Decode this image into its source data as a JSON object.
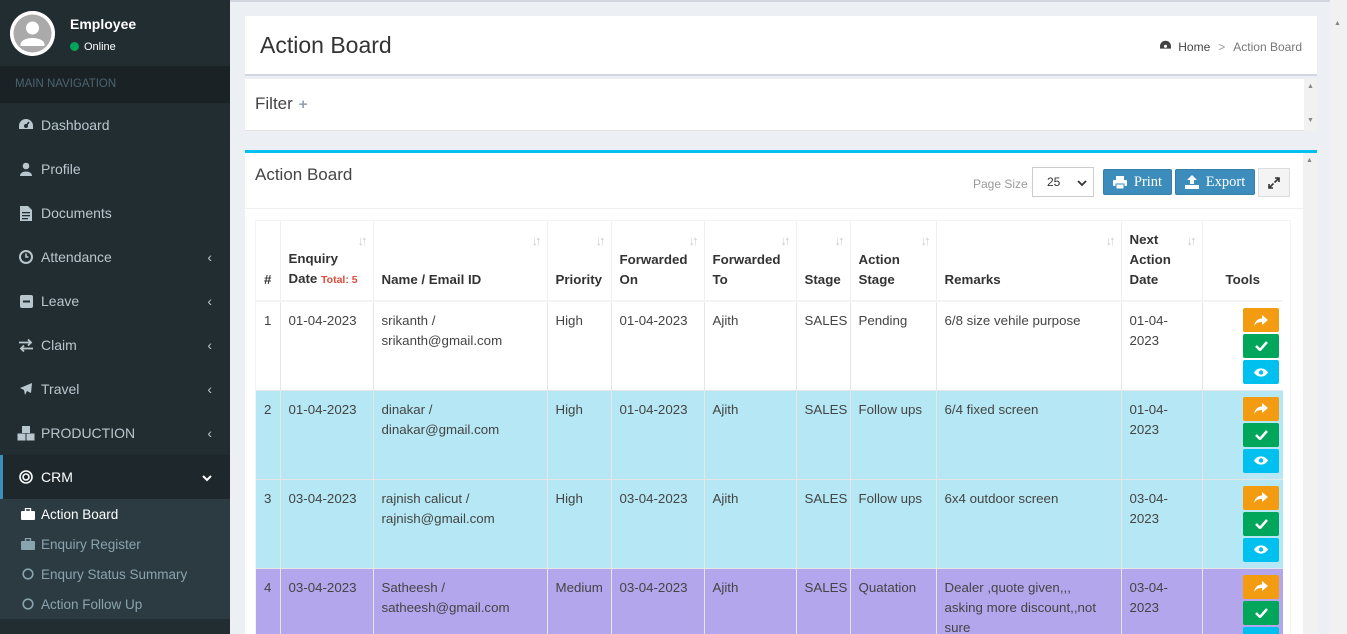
{
  "user": {
    "name": "Employee",
    "status": "Online"
  },
  "nav": {
    "header": "MAIN NAVIGATION",
    "items": [
      {
        "label": "Dashboard",
        "icon": "dashboard-icon",
        "chevron": false
      },
      {
        "label": "Profile",
        "icon": "user-icon",
        "chevron": false
      },
      {
        "label": "Documents",
        "icon": "document-icon",
        "chevron": false
      },
      {
        "label": "Attendance",
        "icon": "clock-icon",
        "chevron": true
      },
      {
        "label": "Leave",
        "icon": "minus-square-icon",
        "chevron": true
      },
      {
        "label": "Claim",
        "icon": "exchange-icon",
        "chevron": true
      },
      {
        "label": "Travel",
        "icon": "plane-icon",
        "chevron": true
      },
      {
        "label": "PRODUCTION",
        "icon": "cubes-icon",
        "chevron": true
      },
      {
        "label": "CRM",
        "icon": "target-icon",
        "chevron": true
      }
    ],
    "crm_sub": [
      {
        "label": "Action Board",
        "icon": "briefcase-icon"
      },
      {
        "label": "Enquiry Register",
        "icon": "briefcase-icon"
      },
      {
        "label": "Enqury Status Summary",
        "icon": "circle-icon"
      },
      {
        "label": "Action Follow Up",
        "icon": "circle-icon"
      }
    ]
  },
  "page": {
    "title": "Action Board",
    "breadcrumb_home": "Home",
    "breadcrumb_sep": ">",
    "breadcrumb_current": "Action Board"
  },
  "filter": {
    "title": "Filter",
    "plus": "+"
  },
  "board": {
    "title": "Action Board",
    "page_size_label": "Page Size",
    "page_size_value": "25",
    "print_label": "Print",
    "export_label": "Export"
  },
  "table": {
    "headers": {
      "num": "#",
      "enquiry_date": "Enquiry Date",
      "total": "Total: 5",
      "name_email": "Name / Email ID",
      "priority": "Priority",
      "forwarded_on": "Forwarded On",
      "forwarded_to": "Forwarded To",
      "stage": "Stage",
      "action_stage": "Action Stage",
      "remarks": "Remarks",
      "next_action_date": "Next Action Date",
      "tools": "Tools"
    },
    "rows": [
      {
        "num": "1",
        "date": "01-04-2023",
        "name": "srikanth /",
        "email": "srikanth@gmail.com",
        "priority": "High",
        "fwd_on": "01-04-2023",
        "fwd_to": "Ajith",
        "stage": "SALES",
        "action_stage": "Pending",
        "remarks": "6/8 size vehile purpose",
        "next": "01-04-2023"
      },
      {
        "num": "2",
        "date": "01-04-2023",
        "name": "dinakar /",
        "email": "dinakar@gmail.com",
        "priority": "High",
        "fwd_on": "01-04-2023",
        "fwd_to": "Ajith",
        "stage": "SALES",
        "action_stage": "Follow ups",
        "remarks": "6/4 fixed screen",
        "next": "01-04-2023"
      },
      {
        "num": "3",
        "date": "03-04-2023",
        "name": "rajnish calicut /",
        "email": "rajnish@gmail.com",
        "priority": "High",
        "fwd_on": "03-04-2023",
        "fwd_to": "Ajith",
        "stage": "SALES",
        "action_stage": "Follow ups",
        "remarks": "6x4 outdoor screen",
        "next": "03-04-2023"
      },
      {
        "num": "4",
        "date": "03-04-2023",
        "name": "Satheesh /",
        "email": "satheesh@gmail.com",
        "priority": "Medium",
        "fwd_on": "03-04-2023",
        "fwd_to": "Ajith",
        "stage": "SALES",
        "action_stage": "Quatation",
        "remarks": "Dealer ,quote given,,, asking more discount,,not sure",
        "next": "03-04-2023"
      }
    ]
  },
  "colors": {
    "sidebar": "#222d32",
    "accent": "#3c8dbc",
    "row_cyan": "#b5e8f4",
    "row_purple": "#b3a6ec"
  }
}
